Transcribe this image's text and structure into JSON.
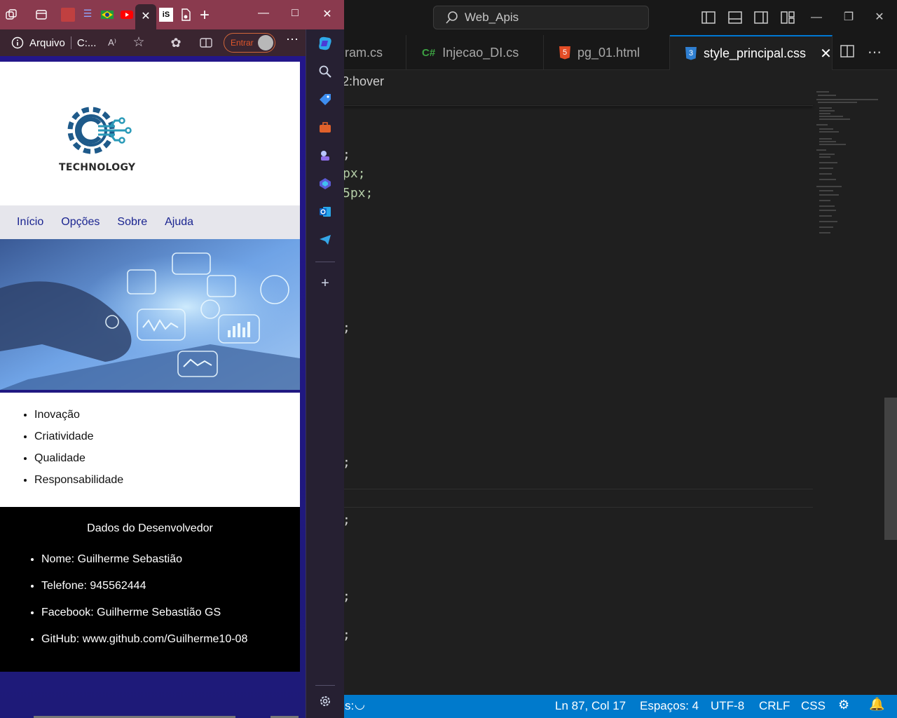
{
  "vscode": {
    "search_text": "Web_Apis",
    "tabs": [
      {
        "icon": "",
        "label": "ram.cs"
      },
      {
        "icon": "C#",
        "label": "Injecao_DI.cs"
      },
      {
        "icon": "5",
        "label": "pg_01.html"
      },
      {
        "icon": "3",
        "label": "style_principal.css",
        "active": true
      }
    ],
    "breadcrumb": "2:hover",
    "code_fragments": [
      ";",
      "px;",
      "5px;",
      ";",
      ";",
      ";",
      ";",
      ";"
    ],
    "statusbar": {
      "left": "s:",
      "position": "Ln 87, Col 17",
      "spaces": "Espaços: 4",
      "encoding": "UTF-8",
      "eol": "CRLF",
      "language": "CSS"
    },
    "colors": {
      "accent": "#007acc",
      "number": "#b5cea8"
    }
  },
  "edge": {
    "address": {
      "info_label": "Arquivo",
      "url": "C:..."
    },
    "signin_label": "Entrar",
    "colors": {
      "tabstrip": "#8a3a4e",
      "toolbar": "#3a2530"
    }
  },
  "site": {
    "logo_text": "TECHNOLOGY",
    "nav": [
      "Início",
      "Opções",
      "Sobre",
      "Ajuda"
    ],
    "values": [
      "Inovação",
      "Criatividade",
      "Qualidade",
      "Responsabilidade"
    ],
    "dev_title": "Dados do Desenvolvedor",
    "dev_items": [
      "Nome: Guilherme Sebastião",
      "Telefone: 945562444",
      "Facebook: Guilherme Sebastião GS",
      "GitHub: www.github.com/Guilherme10-08"
    ],
    "colors": {
      "nav_link": "#1a2490",
      "footer_bg": "#000000",
      "page_bg": "#23168a"
    }
  }
}
